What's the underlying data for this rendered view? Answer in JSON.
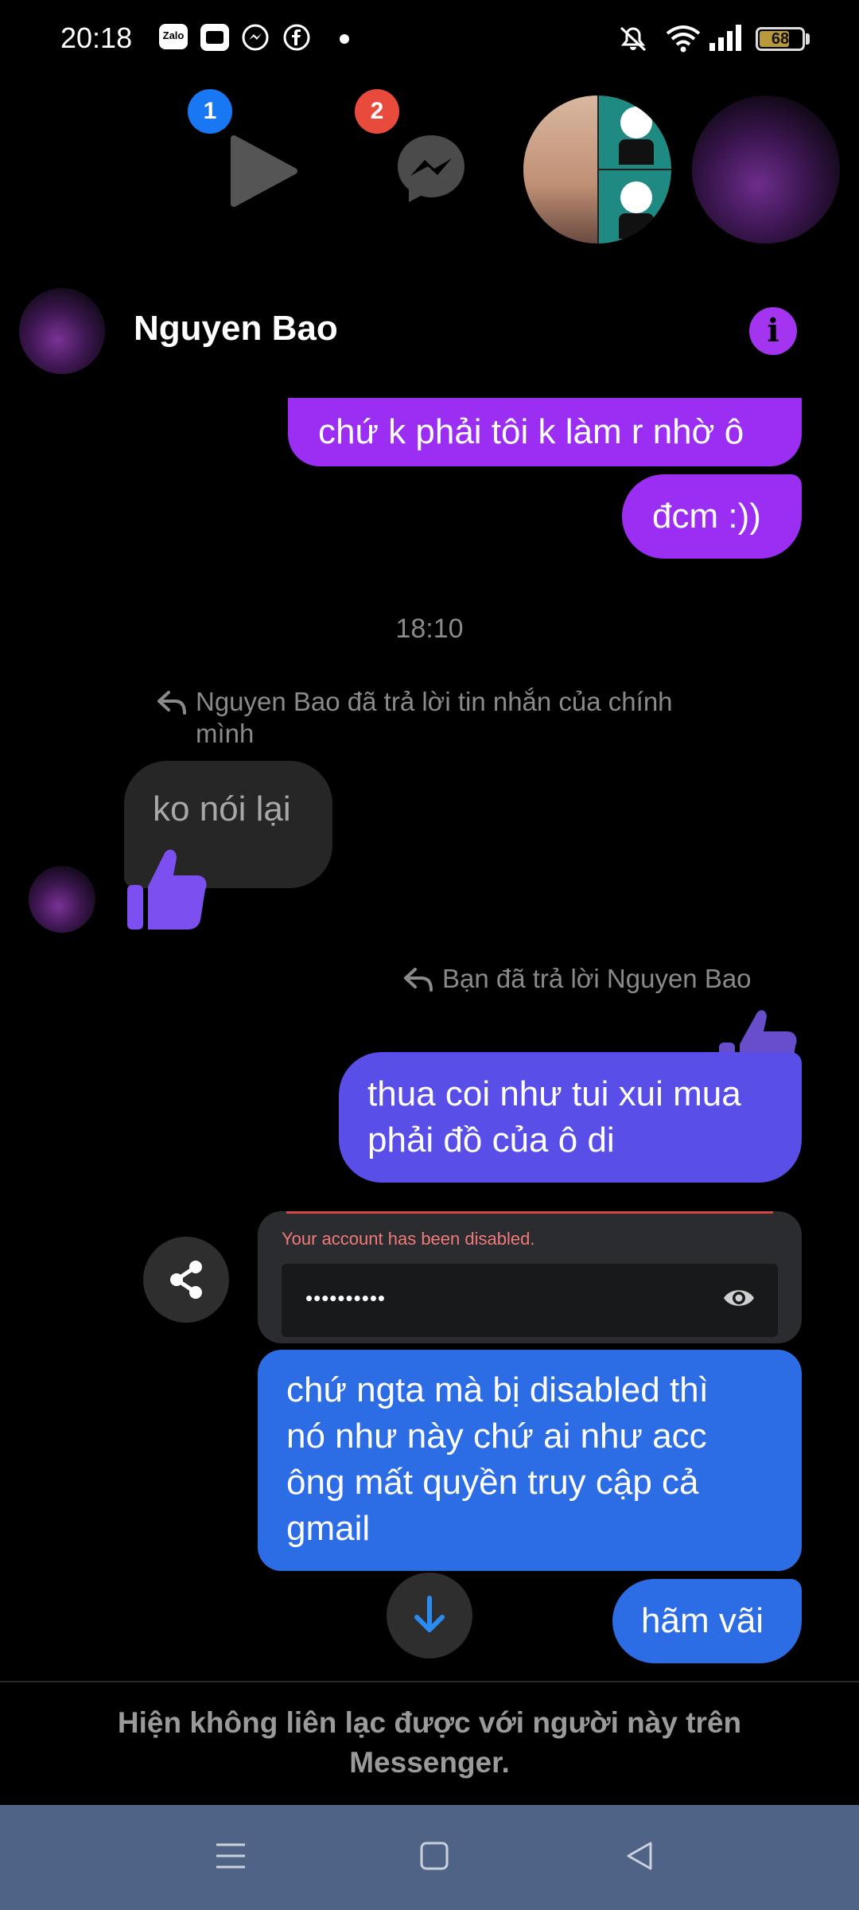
{
  "status_bar": {
    "time": "20:18",
    "battery": "68",
    "battery_level_percent": 68,
    "notification_icons": [
      "zalo-icon",
      "app-icon",
      "messenger-icon",
      "facebook-icon",
      "dot-icon"
    ],
    "system_icons": [
      "mute-icon",
      "wifi-icon",
      "signal-icon",
      "battery-icon"
    ]
  },
  "chat_heads": {
    "badge_1": "1",
    "badge_2": "2",
    "colors": {
      "badge_blue": "#1877f2",
      "badge_red": "#e84b3c"
    }
  },
  "header": {
    "contact_name": "Nguyen Bao",
    "info_icon": "i"
  },
  "messages": {
    "m1": "chứ k phải tôi k làm r nhờ ô",
    "m2": "đcm :))",
    "timestamp": "18:10",
    "reply_note_1": "Nguyen Bao đã trả lời tin nhắn của chính mình",
    "m3": "ko nói lại",
    "reply_note_2": "Bạn đã trả lời Nguyen Bao",
    "m4_line1": "thua coi như tui xui mua",
    "m4_line2": "phải đồ của ô di",
    "attachment_error": "Your account has been disabled.",
    "attachment_password": "••••••••••",
    "m5_line1": "chứ ngta mà bị disabled thì",
    "m5_line2": "nó như này chứ ai như acc",
    "m5_line3": "ông mất quyền truy cập cả",
    "m5_line4": "gmail",
    "m6": "hãm vãi"
  },
  "footer": {
    "line1": "Hiện không liên lạc được với người này trên",
    "line2": "Messenger."
  },
  "colors": {
    "accent_purple": "#a335f0",
    "bubble_purple": "#9b2ef2",
    "bubble_indigo": "#5a4ee8",
    "bubble_blue": "#2c6ce5",
    "bubble_gray": "#262626",
    "nav_bar": "#4f6387"
  }
}
